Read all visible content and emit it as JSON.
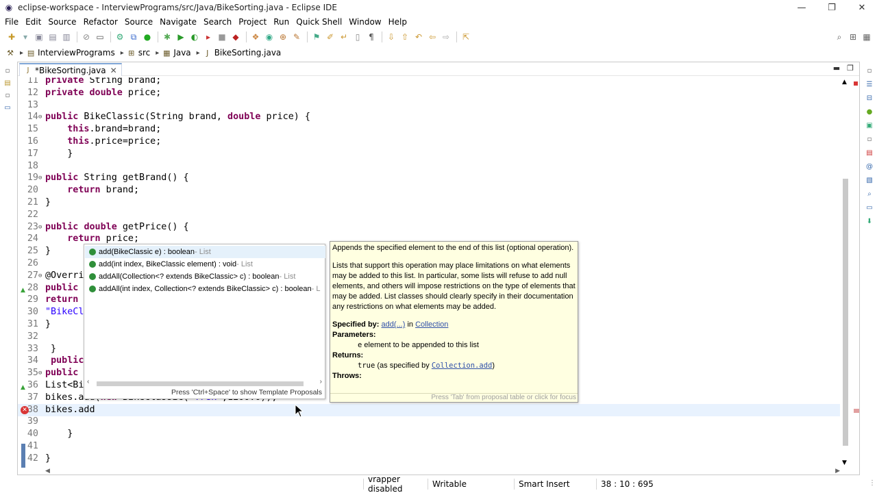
{
  "window": {
    "title": "eclipse-workspace - InterviewPrograms/src/Java/BikeSorting.java - Eclipse IDE",
    "controls": [
      "minimize",
      "restore",
      "close"
    ]
  },
  "menu": [
    "File",
    "Edit",
    "Source",
    "Refactor",
    "Source",
    "Navigate",
    "Search",
    "Project",
    "Run",
    "Quick Shell",
    "Window",
    "Help"
  ],
  "breadcrumb": {
    "project": "InterviewPrograms",
    "folder": "src",
    "package": "Java",
    "file": "BikeSorting.java"
  },
  "editor_tab": {
    "label": "*BikeSorting.java"
  },
  "code_lines": [
    {
      "n": "11",
      "text": "private String brand;"
    },
    {
      "n": "12",
      "text": "private double price;"
    },
    {
      "n": "13",
      "text": ""
    },
    {
      "n": "14",
      "text": "public BikeClassic(String brand, double price) {"
    },
    {
      "n": "15",
      "text": "    this.brand=brand;"
    },
    {
      "n": "16",
      "text": "    this.price=price;"
    },
    {
      "n": "17",
      "text": "    }"
    },
    {
      "n": "18",
      "text": ""
    },
    {
      "n": "19",
      "text": "public String getBrand() {"
    },
    {
      "n": "20",
      "text": "    return brand;"
    },
    {
      "n": "21",
      "text": "}"
    },
    {
      "n": "22",
      "text": ""
    },
    {
      "n": "23",
      "text": "public double getPrice() {"
    },
    {
      "n": "24",
      "text": "    return price;"
    },
    {
      "n": "25",
      "text": "}"
    },
    {
      "n": "26",
      "text": ""
    },
    {
      "n": "27",
      "text": "@Overri"
    },
    {
      "n": "28",
      "text": "public "
    },
    {
      "n": "29",
      "text": "return "
    },
    {
      "n": "30",
      "text": "\"BikeCl"
    },
    {
      "n": "31",
      "text": "}"
    },
    {
      "n": "32",
      "text": ""
    },
    {
      "n": "33",
      "text": " }"
    },
    {
      "n": "34",
      "text": " public"
    },
    {
      "n": "35",
      "text": "public "
    },
    {
      "n": "36",
      "text": "List<Bi"
    },
    {
      "n": "37",
      "text": "bikes.add(new BikeClassic(\"Trek\",1200.0));"
    },
    {
      "n": "38",
      "text": "bikes.add"
    },
    {
      "n": "39",
      "text": ""
    },
    {
      "n": "40",
      "text": "    }"
    },
    {
      "n": "41",
      "text": ""
    },
    {
      "n": "42",
      "text": "}"
    }
  ],
  "proposals": {
    "items": [
      {
        "sig": "add(BikeClassic e) : boolean",
        "owner": " - List"
      },
      {
        "sig": "add(int index, BikeClassic element) : void",
        "owner": " - List"
      },
      {
        "sig": "addAll(Collection<? extends BikeClassic> c) : boolean",
        "owner": " - List"
      },
      {
        "sig": "addAll(int index, Collection<? extends BikeClassic> c) : boolean",
        "owner": " - L"
      }
    ],
    "hint": "Press 'Ctrl+Space' to show Template Proposals"
  },
  "javadoc": {
    "p1": "Appends the specified element to the end of this list (optional operation).",
    "p2": "Lists that support this operation may place limitations on what elements may be added to this list. In particular, some lists will refuse to add null elements, and others will impose restrictions on the type of elements that may be added. List classes should clearly specify in their documentation any restrictions on what elements may be added.",
    "specified_by_label": "Specified by:",
    "specified_by_method": "add(...)",
    "specified_by_in": " in ",
    "specified_by_class": "Collection",
    "parameters_label": "Parameters:",
    "param_name": "e",
    "param_desc": " element to be appended to this list",
    "returns_label": "Returns:",
    "returns_code": "true",
    "returns_mid": " (as specified by ",
    "returns_link": "Collection.add",
    "returns_end": ")",
    "throws_label": "Throws:",
    "focus_hint": "Press 'Tab' from proposal table or click for focus"
  },
  "status": {
    "wrapper": "vrapper disabled",
    "mode": "Writable",
    "insert": "Smart Insert",
    "position": "38 : 10 : 695"
  },
  "colors": {
    "keyword": "#7f0055",
    "string": "#2a00ff",
    "current_line": "#e8f2fe",
    "javadoc_bg": "#ffffe1"
  }
}
